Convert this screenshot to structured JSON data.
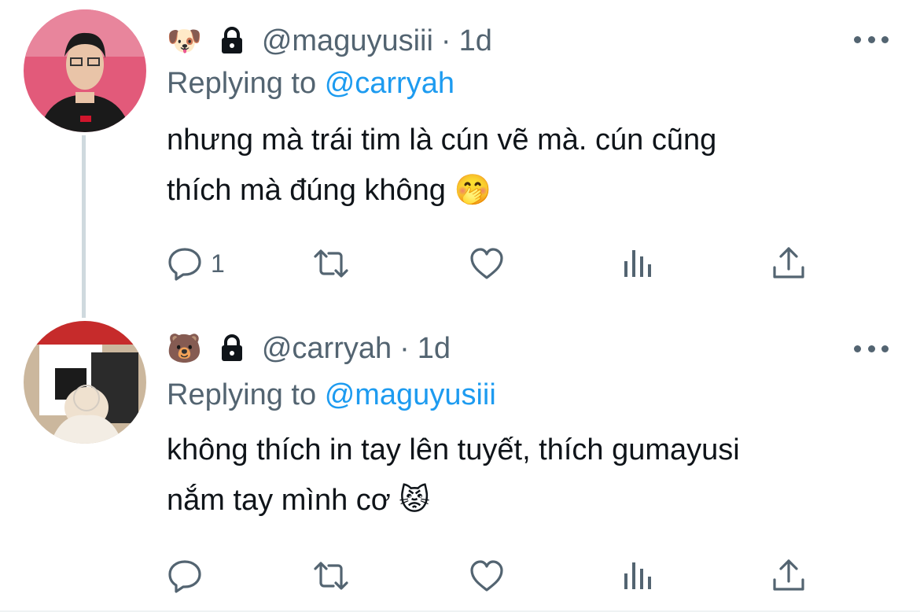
{
  "tweets": [
    {
      "emoji": "🐶",
      "handle": "@maguyusiii",
      "separator": "·",
      "time": "1d",
      "replying_label": "Replying to",
      "replying_to": "@carryah",
      "text_line1": "nhưng mà trái tim là cún vẽ mà. cún cũng",
      "text_line2": "thích mà đúng không 🤭",
      "reply_count": "1"
    },
    {
      "emoji": "🐻",
      "handle": "@carryah",
      "separator": "·",
      "time": "1d",
      "replying_label": "Replying to",
      "replying_to": "@maguyusiii",
      "text_line1": "không thích in tay lên tuyết, thích gumayusi",
      "text_line2": "nắm tay mình cơ 😾",
      "reply_count": ""
    }
  ],
  "colors": {
    "accent": "#1d9bf0",
    "secondary": "#536471",
    "text": "#0f1419",
    "thread_line": "#cfd9de"
  },
  "icons": [
    "dog-emoji",
    "lock-icon",
    "more-icon",
    "reply-icon",
    "retweet-icon",
    "like-icon",
    "views-icon",
    "share-icon"
  ]
}
